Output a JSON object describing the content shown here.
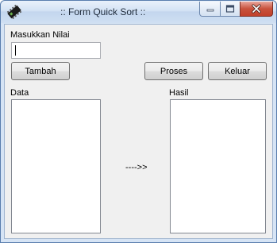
{
  "window": {
    "title": ":: Form Quick Sort ::",
    "icon": "chip-icon",
    "controls": {
      "minimize": "minimize-icon",
      "maximize": "maximize-icon",
      "close": "close-icon"
    }
  },
  "form": {
    "input_label": "Masukkan Nilai",
    "input_value": "",
    "add_button": "Tambah",
    "process_button": "Proses",
    "exit_button": "Keluar",
    "data_label": "Data",
    "result_label": "Hasil",
    "arrow_text": "---->>",
    "data_items": [],
    "result_items": []
  }
}
